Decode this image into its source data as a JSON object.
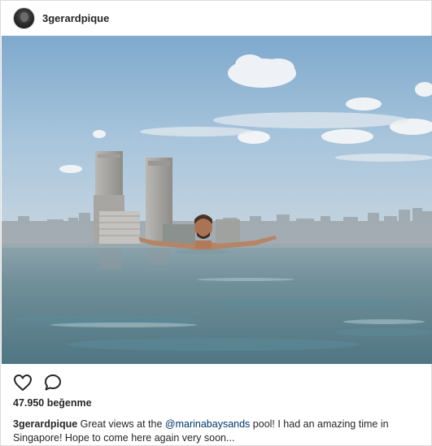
{
  "post": {
    "username": "3gerardpique",
    "likes_text": "47.950 beğenme",
    "caption": {
      "username": "3gerardpique",
      "text_before": "Great views at the ",
      "mention": "@marinabaysands",
      "text_after": " pool! I had an amazing time in Singapore! Hope to come here again very soon..."
    },
    "icons": {
      "like": "heart-outline-icon",
      "comment": "comment-bubble-icon"
    }
  }
}
